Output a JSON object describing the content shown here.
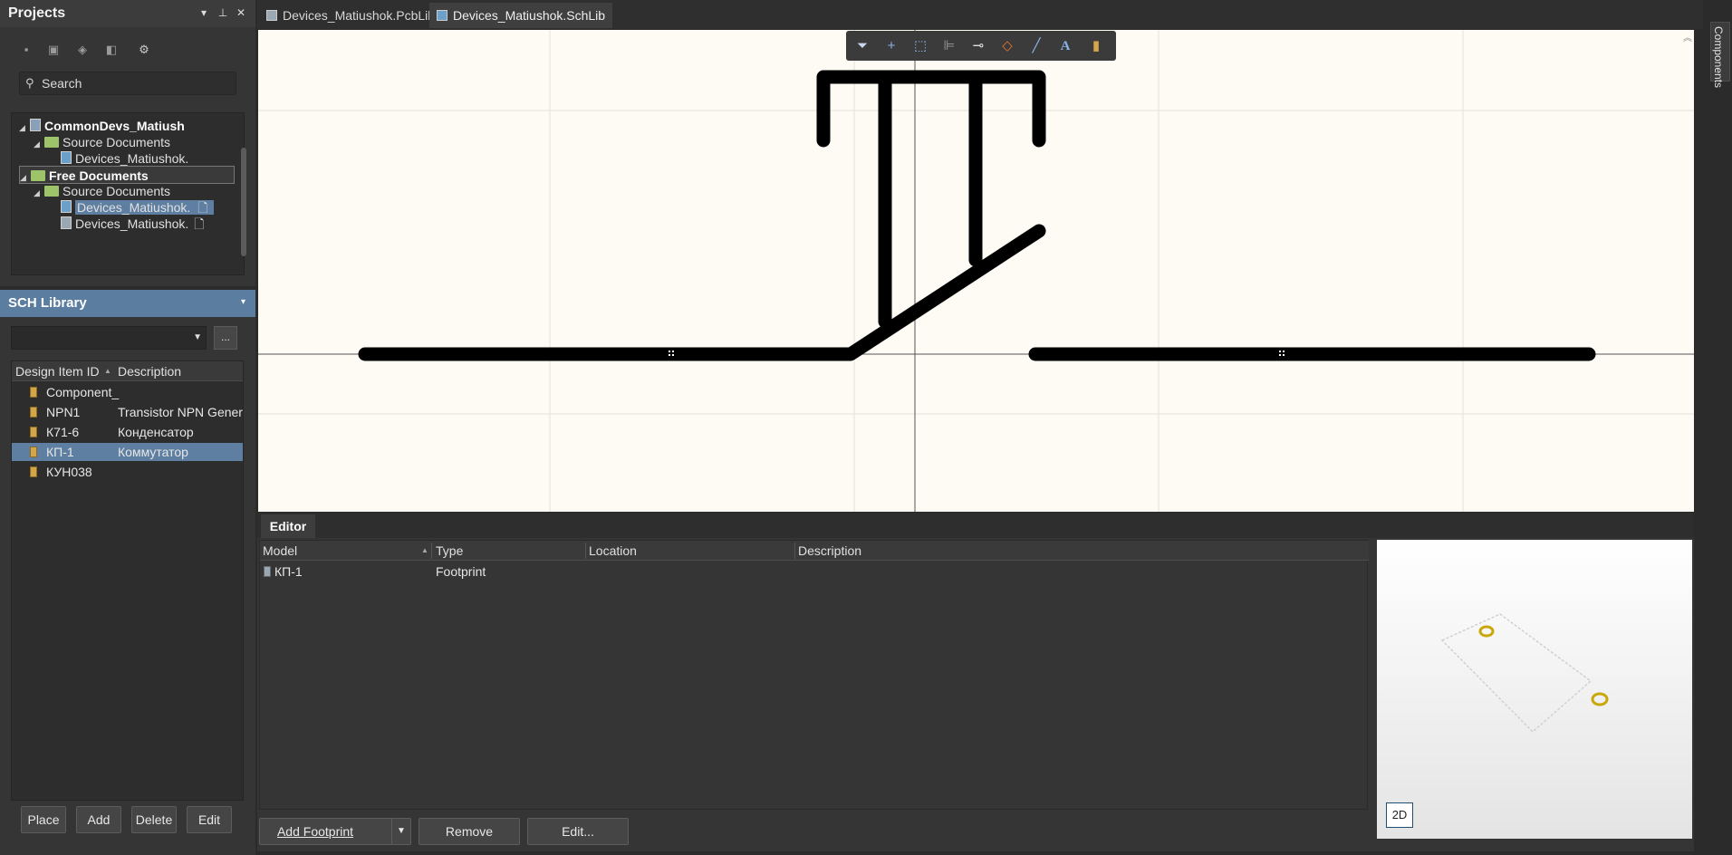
{
  "projects": {
    "title": "Projects",
    "header_buttons": [
      "▾",
      "⊥",
      "✕"
    ],
    "toolbar_icons": [
      "save-icon",
      "save-all-icon",
      "project-options-icon",
      "close-project-icon",
      "gear-icon"
    ],
    "search_placeholder": "Search",
    "tree": [
      {
        "label": "CommonDevs_Matiush",
        "kind": "project",
        "bold": true
      },
      {
        "label": "Source Documents",
        "kind": "folder"
      },
      {
        "label": "Devices_Matiushok.",
        "kind": "document"
      },
      {
        "label": "Free Documents",
        "kind": "folder",
        "bold": true
      },
      {
        "label": "Source Documents",
        "kind": "folder"
      },
      {
        "label": "Devices_Matiushok.",
        "kind": "document",
        "selected": true
      },
      {
        "label": "Devices_Matiushok.",
        "kind": "document"
      }
    ]
  },
  "schlib": {
    "title": "SCH Library",
    "more_label": "...",
    "columns": [
      "Design Item ID",
      "Description"
    ],
    "rows": [
      {
        "id": "Component_",
        "desc": ""
      },
      {
        "id": "NPN1",
        "desc": "Transistor NPN Generic"
      },
      {
        "id": "К71-6",
        "desc": "Конденсатор"
      },
      {
        "id": "КП-1",
        "desc": "Коммутатор",
        "selected": true
      },
      {
        "id": "КУН038",
        "desc": ""
      }
    ],
    "buttons": {
      "place": "Place",
      "add": "Add",
      "delete": "Delete",
      "edit": "Edit"
    }
  },
  "tabs": [
    {
      "label": "Devices_Matiushok.PcbLib",
      "active": false
    },
    {
      "label": "Devices_Matiushok.SchLib",
      "active": true
    }
  ],
  "sch_toolbar": [
    "filter-icon",
    "plus-icon",
    "select-rect-icon",
    "align-icon",
    "pin-icon",
    "eraser-icon",
    "line-icon",
    "text-icon",
    "component-icon"
  ],
  "editor": {
    "tab": "Editor",
    "columns": [
      "Model",
      "Type",
      "Location",
      "Description"
    ],
    "rows": [
      {
        "model": "КП-1",
        "type": "Footprint",
        "location": "",
        "description": ""
      }
    ],
    "add_footprint": "Add Footprint",
    "remove": "Remove",
    "edit": "Edit...",
    "view_mode": "2D"
  },
  "right_panel": {
    "components_tab": "Components"
  },
  "colors": {
    "canvas_bg": "#fdfbf4",
    "selection": "#5e7fa1",
    "panel_bg": "#353535",
    "header_accent": "#5b7da0"
  }
}
